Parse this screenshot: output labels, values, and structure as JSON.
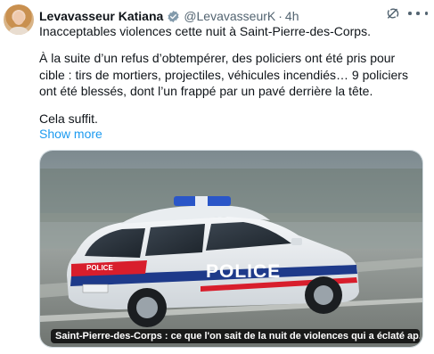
{
  "author": {
    "name": "Levavasseur Katiana",
    "handle": "@LevavasseurK",
    "time": "4h",
    "dot": "·"
  },
  "tweet": {
    "line1": "Inacceptables violences cette nuit à Saint-Pierre-des-Corps.",
    "line2": "À la suite d’un refus d’obtempérer, des policiers ont été pris pour cible : tirs de mortiers, projectiles, véhicules incendiés… 9 policiers ont été blessés, dont l’un frappé par un pavé derrière la tête.",
    "line3": "Cela suffit.",
    "show_more": "Show more"
  },
  "media": {
    "caption": "Saint-Pierre-des-Corps : ce que l'on sait de la nuit de violences qui a éclaté ap...",
    "car_text": "POLICE",
    "car_text_small": "POLICE"
  },
  "icons": {
    "verified": "verified-badge-icon",
    "grok": "grok-icon",
    "more": "more-options-icon"
  },
  "colors": {
    "link": "#1d9bf0",
    "secondary_text": "#536471",
    "verified": "#829aab",
    "police_blue": "#1e3a8a",
    "police_red": "#d81e2c"
  }
}
